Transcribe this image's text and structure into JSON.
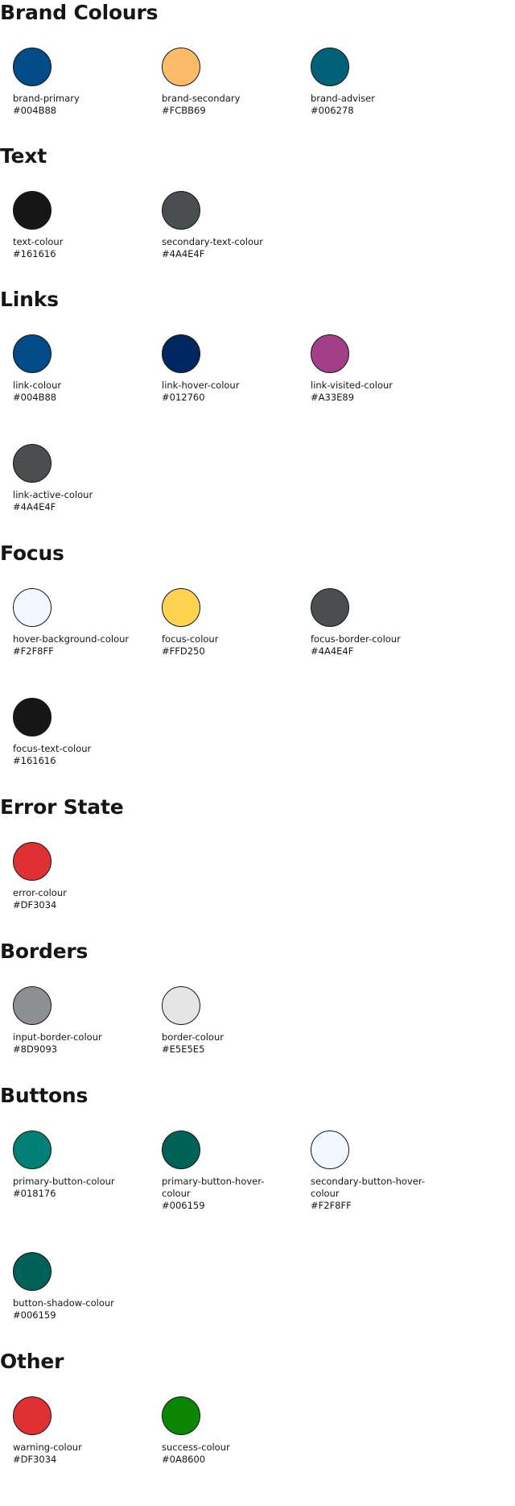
{
  "sections": [
    {
      "title": "Brand Colours",
      "swatches": [
        {
          "name": "brand-primary",
          "hex": "#004B88",
          "color": "#004B88"
        },
        {
          "name": "brand-secondary",
          "hex": "#FCBB69",
          "color": "#FCBB69"
        },
        {
          "name": "brand-adviser",
          "hex": "#006278",
          "color": "#006278"
        }
      ]
    },
    {
      "title": "Text",
      "swatches": [
        {
          "name": "text-colour",
          "hex": "#161616",
          "color": "#161616"
        },
        {
          "name": "secondary-text-colour",
          "hex": "#4A4E4F",
          "color": "#4A4E4F"
        }
      ]
    },
    {
      "title": "Links",
      "swatches": [
        {
          "name": "link-colour",
          "hex": "#004B88",
          "color": "#004B88"
        },
        {
          "name": "link-hover-colour",
          "hex": "#012760",
          "color": "#012760"
        },
        {
          "name": "link-visited-colour",
          "hex": "#A33E89",
          "color": "#A33E89"
        },
        {
          "name": "link-active-colour",
          "hex": "#4A4E4F",
          "color": "#4A4E4F"
        }
      ]
    },
    {
      "title": "Focus",
      "swatches": [
        {
          "name": "hover-background-colour",
          "hex": "#F2F8FF",
          "color": "#F2F8FF"
        },
        {
          "name": "focus-colour",
          "hex": "#FFD250",
          "color": "#FFD250"
        },
        {
          "name": "focus-border-colour",
          "hex": "#4A4E4F",
          "color": "#4A4E4F"
        },
        {
          "name": "focus-text-colour",
          "hex": "#161616",
          "color": "#161616"
        }
      ]
    },
    {
      "title": "Error State",
      "swatches": [
        {
          "name": "error-colour",
          "hex": "#DF3034",
          "color": "#DF3034"
        }
      ]
    },
    {
      "title": "Borders",
      "swatches": [
        {
          "name": "input-border-colour",
          "hex": "#8D9093",
          "color": "#8D9093"
        },
        {
          "name": "border-colour",
          "hex": "#E5E5E5",
          "color": "#E5E5E5"
        }
      ]
    },
    {
      "title": "Buttons",
      "swatches": [
        {
          "name": "primary-button-colour",
          "hex": "#018176",
          "color": "#018176"
        },
        {
          "name": "primary-button-hover-colour",
          "hex": "#006159",
          "color": "#006159"
        },
        {
          "name": "secondary-button-hover-colour",
          "hex": "#F2F8FF",
          "color": "#F2F8FF"
        },
        {
          "name": "button-shadow-colour",
          "hex": "#006159",
          "color": "#006159"
        }
      ]
    },
    {
      "title": "Other",
      "swatches": [
        {
          "name": "warning-colour",
          "hex": "#DF3034",
          "color": "#DF3034"
        },
        {
          "name": "success-colour",
          "hex": "#0A8600",
          "color": "#0A8600"
        }
      ]
    }
  ]
}
